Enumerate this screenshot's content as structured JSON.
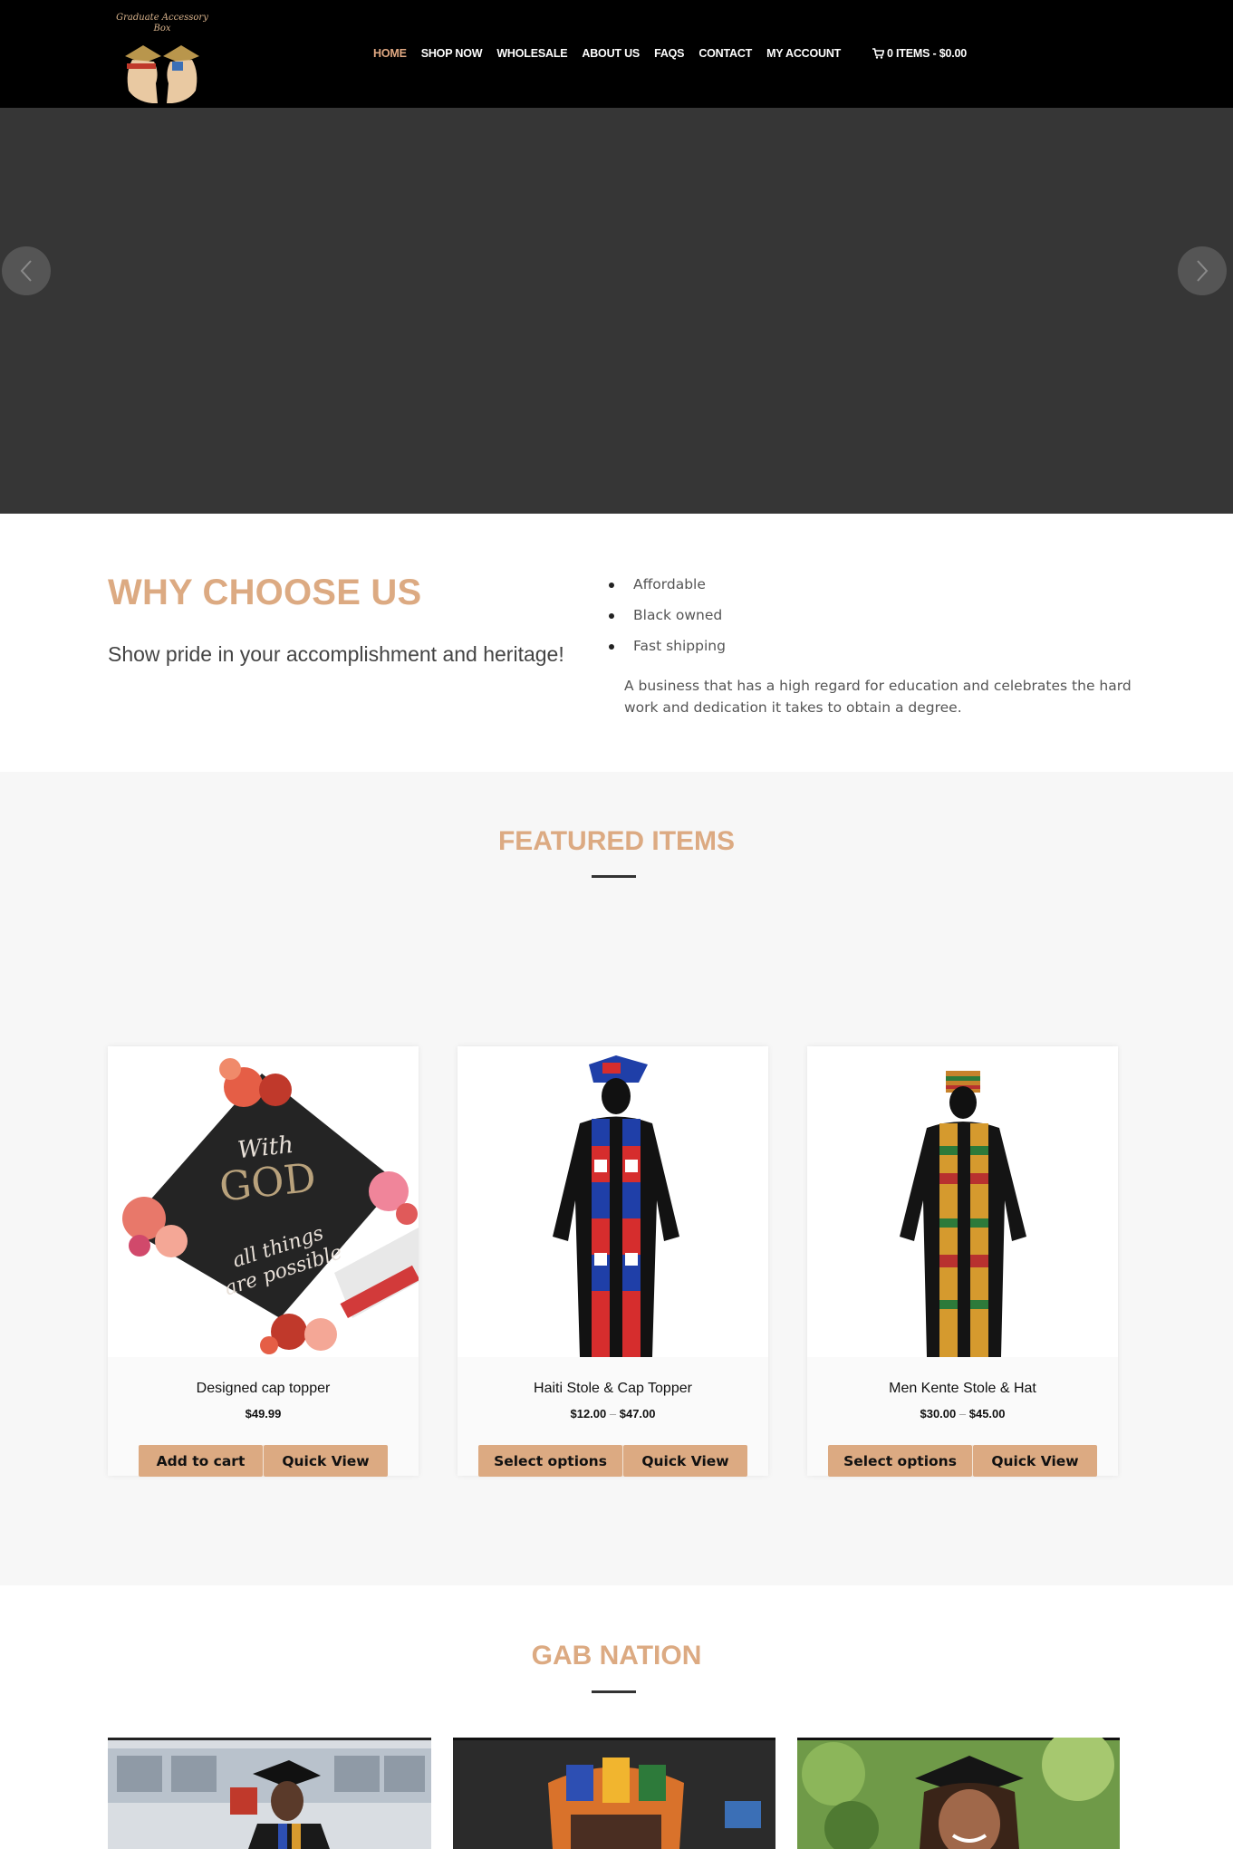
{
  "header": {
    "logo_text_line1": "Graduate Accessory",
    "logo_text_line2": "Box",
    "nav": [
      {
        "label": "HOME",
        "active": true
      },
      {
        "label": "SHOP NOW",
        "active": false
      },
      {
        "label": "WHOLESALE",
        "active": false
      },
      {
        "label": "ABOUT US",
        "active": false
      },
      {
        "label": "FAQS",
        "active": false
      },
      {
        "label": "CONTACT",
        "active": false
      },
      {
        "label": "MY ACCOUNT",
        "active": false
      }
    ],
    "cart_label": "0 ITEMS - $0.00",
    "icons": {
      "cart": "cart-icon",
      "prev": "chevron-left-icon",
      "next": "chevron-right-icon"
    }
  },
  "why": {
    "title": "WHY CHOOSE US",
    "subtitle": "Show pride in your accomplishment and heritage!",
    "points": [
      "Affordable",
      "Black owned",
      "Fast shipping"
    ],
    "description": "A business that has a high regard for education and celebrates the hard work and dedication it takes to obtain a degree."
  },
  "featured": {
    "title": "FEATURED ITEMS",
    "products": [
      {
        "name": "Designed cap topper",
        "price_low": "$49.99",
        "price_high": "",
        "primary_button": "Add to cart",
        "secondary_button": "Quick View"
      },
      {
        "name": "Haiti Stole & Cap Topper",
        "price_low": "$12.00",
        "price_sep": "–",
        "price_high": "$47.00",
        "primary_button": "Select options",
        "secondary_button": "Quick View"
      },
      {
        "name": "Men Kente Stole & Hat",
        "price_low": "$30.00",
        "price_sep": "–",
        "price_high": "$45.00",
        "primary_button": "Select options",
        "secondary_button": "Quick View"
      }
    ],
    "cap_text": {
      "line1": "With",
      "line2": "GOD",
      "line3": "all things",
      "line4": "are possible"
    }
  },
  "gab": {
    "title": "GAB NATION"
  },
  "colors": {
    "accent": "#dcaa82",
    "header_bg": "#000000",
    "hero_bg": "#363636",
    "section_bg": "#f7f7f7"
  }
}
